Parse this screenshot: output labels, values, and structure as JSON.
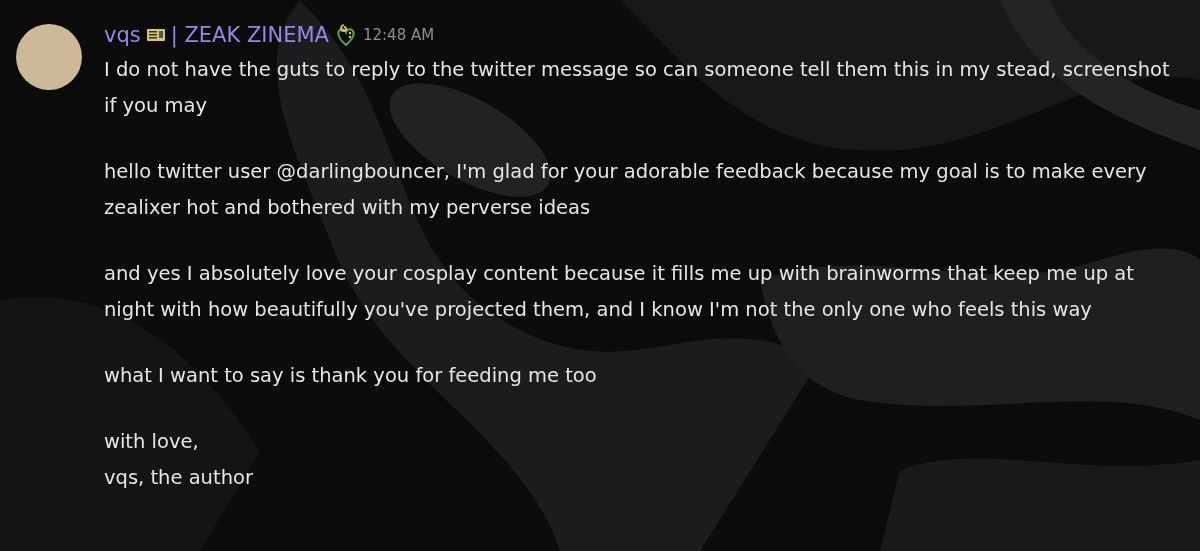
{
  "message": {
    "author": "vqs",
    "role": "| ZEAK ZINEMA",
    "timestamp": "12:48 AM",
    "paragraphs": [
      "I do not have the guts to reply to the twitter message so can someone tell them this in my stead, screenshot if you may",
      "hello twitter user @darlingbouncer, I'm glad for your adorable feedback because my goal is to make every zealixer hot and bothered with my perverse ideas",
      "and yes I absolutely love your cosplay content because it fills me up with brainworms that keep me up at night with how beautifully you've projected them, and I know I'm not the only one who feels this way",
      "what I want to say is thank you for feeding me too",
      "with love,\nvqs, the author"
    ]
  }
}
